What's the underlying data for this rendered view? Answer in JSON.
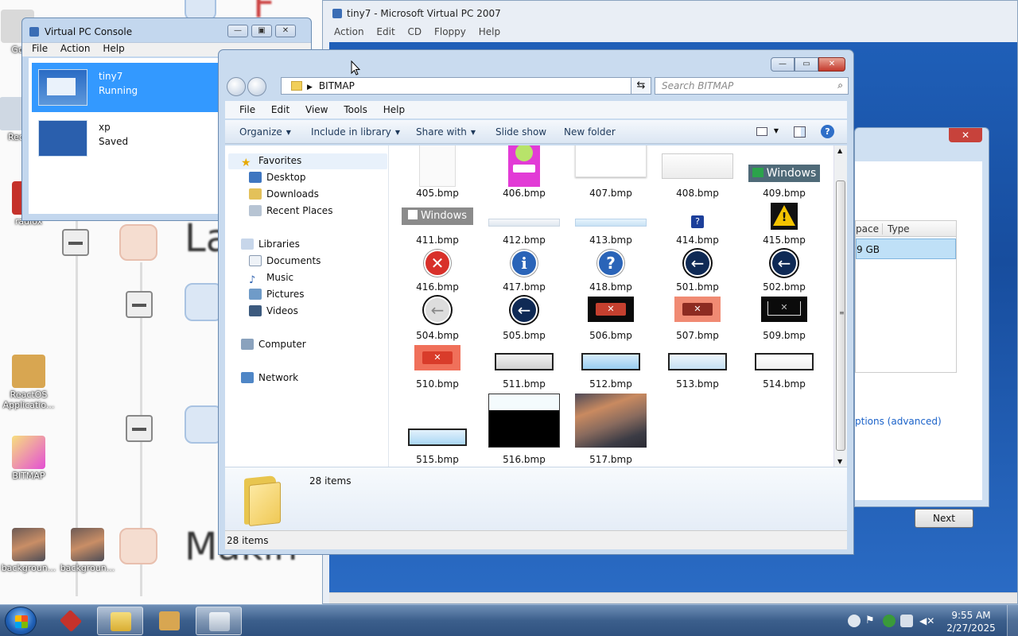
{
  "desktop_icons": [
    {
      "label": "Go",
      "id": "go"
    },
    {
      "label": "Rec",
      "id": "rec"
    },
    {
      "label": "radiox",
      "id": "radiox"
    },
    {
      "label": "ReactOS Applicatio...",
      "id": "reactos"
    },
    {
      "label": "BITMAP",
      "id": "bitmap"
    },
    {
      "label": "backgroun...",
      "id": "bg1"
    },
    {
      "label": "backgroun...",
      "id": "bg2"
    }
  ],
  "vpc_window": {
    "title": "tiny7 - Microsoft Virtual PC 2007",
    "menu": [
      "Action",
      "Edit",
      "CD",
      "Floppy",
      "Help"
    ]
  },
  "installer": {
    "col_space": "pace",
    "col_type": "Type",
    "row_value": "9 GB",
    "link": "ptions (advanced)",
    "next_label": "Next",
    "close": "✕"
  },
  "console": {
    "title": "Virtual PC Console",
    "menu": [
      "File",
      "Action",
      "Help"
    ],
    "vms": [
      {
        "name": "tiny7",
        "status": "Running"
      },
      {
        "name": "xp",
        "status": "Saved"
      }
    ]
  },
  "explorer": {
    "address": "BITMAP",
    "search_placeholder": "Search BITMAP",
    "menu": [
      "File",
      "Edit",
      "View",
      "Tools",
      "Help"
    ],
    "commands": [
      "Organize",
      "Include in library",
      "Share with",
      "Slide show",
      "New folder"
    ],
    "nav": {
      "favorites": "Favorites",
      "fav_items": [
        "Desktop",
        "Downloads",
        "Recent Places"
      ],
      "libraries": "Libraries",
      "lib_items": [
        "Documents",
        "Music",
        "Pictures",
        "Videos"
      ],
      "computer": "Computer",
      "network": "Network"
    },
    "files": [
      {
        "name": "405.bmp",
        "kind": "blank"
      },
      {
        "name": "406.bmp",
        "kind": "magenta"
      },
      {
        "name": "407.bmp",
        "kind": "wide-blank"
      },
      {
        "name": "408.bmp",
        "kind": "wide-grey"
      },
      {
        "name": "409.bmp",
        "kind": "windows-banner",
        "text": "Windows"
      },
      {
        "name": "411.bmp",
        "kind": "windows-logo",
        "text": "Windows"
      },
      {
        "name": "412.bmp",
        "kind": "thin-bar"
      },
      {
        "name": "413.bmp",
        "kind": "thin-bar-blue"
      },
      {
        "name": "414.bmp",
        "kind": "small-question"
      },
      {
        "name": "415.bmp",
        "kind": "warning"
      },
      {
        "name": "416.bmp",
        "kind": "error"
      },
      {
        "name": "417.bmp",
        "kind": "info"
      },
      {
        "name": "418.bmp",
        "kind": "question"
      },
      {
        "name": "501.bmp",
        "kind": "back-arrow"
      },
      {
        "name": "502.bmp",
        "kind": "back-arrow"
      },
      {
        "name": "504.bmp",
        "kind": "back-arrow-grey"
      },
      {
        "name": "505.bmp",
        "kind": "back-arrow"
      },
      {
        "name": "506.bmp",
        "kind": "close-dark"
      },
      {
        "name": "507.bmp",
        "kind": "close-orange"
      },
      {
        "name": "509.bmp",
        "kind": "close-outline"
      },
      {
        "name": "510.bmp",
        "kind": "close-red"
      },
      {
        "name": "511.bmp",
        "kind": "button-grey"
      },
      {
        "name": "512.bmp",
        "kind": "button-blue"
      },
      {
        "name": "513.bmp",
        "kind": "button-light"
      },
      {
        "name": "514.bmp",
        "kind": "button-white"
      },
      {
        "name": "515.bmp",
        "kind": "button-blue-sm"
      },
      {
        "name": "516.bmp",
        "kind": "black-split"
      },
      {
        "name": "517.bmp",
        "kind": "photo"
      }
    ],
    "item_count": "28 items",
    "status": "28 items"
  },
  "taskbar": {
    "time": "9:55 AM",
    "date": "2/27/2025"
  }
}
